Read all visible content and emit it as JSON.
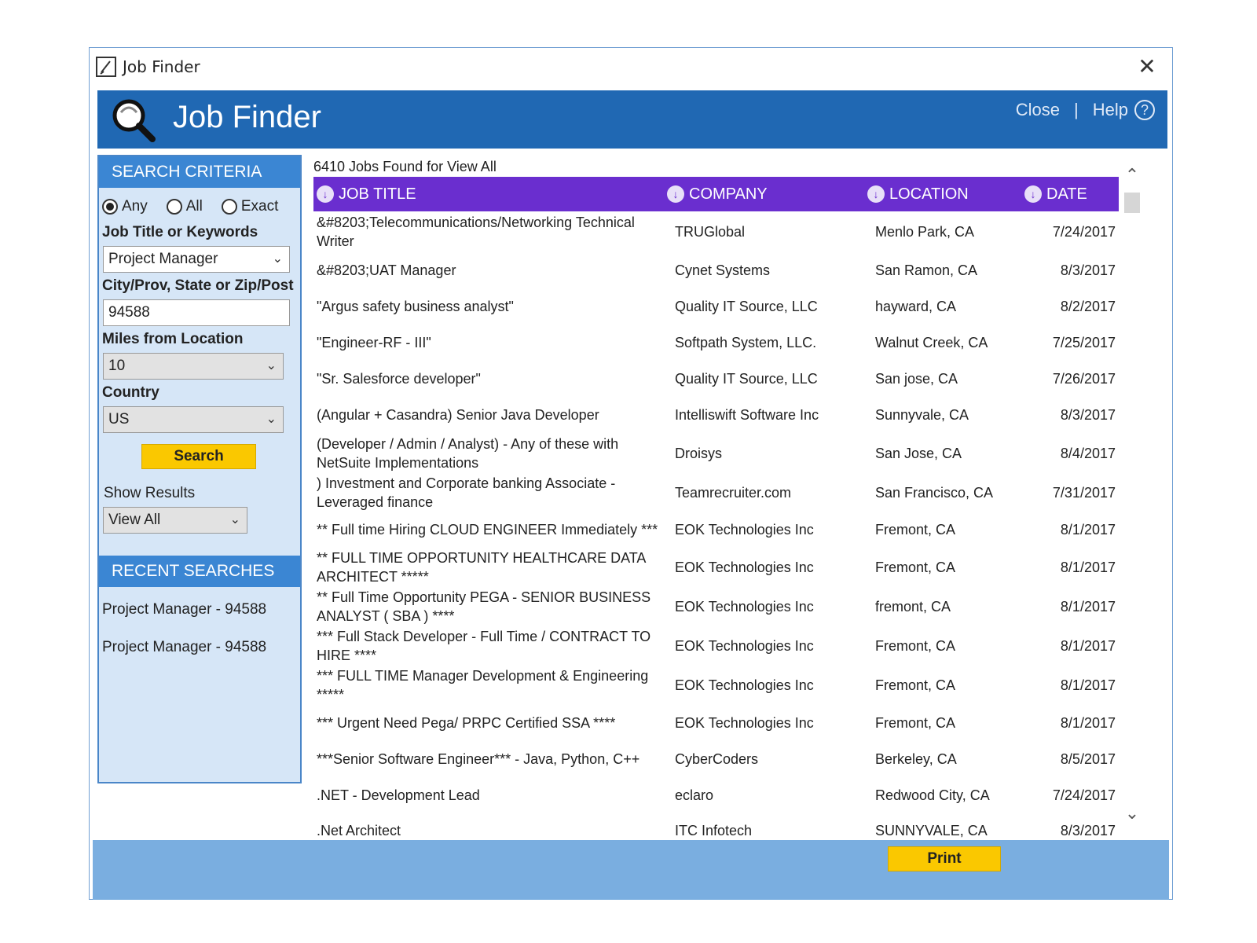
{
  "window": {
    "title": "Job Finder",
    "close_glyph": "✕"
  },
  "banner": {
    "title": "Job Finder",
    "close_label": "Close",
    "separator": "|",
    "help_label": "Help",
    "help_glyph": "?",
    "color": "#2068b3"
  },
  "sidebar": {
    "header": "SEARCH CRITERIA",
    "radios": [
      {
        "label": "Any",
        "selected": true
      },
      {
        "label": "All",
        "selected": false
      },
      {
        "label": "Exact",
        "selected": false
      }
    ],
    "keywords_label": "Job Title or Keywords",
    "keywords_value": "Project Manager",
    "location_label": "City/Prov, State or Zip/Post",
    "location_value": "94588",
    "miles_label": "Miles from Location",
    "miles_value": "10",
    "country_label": "Country",
    "country_value": "US",
    "search_button": "Search",
    "show_results_label": "Show Results",
    "show_results_value": "View All",
    "recent_header": "RECENT SEARCHES",
    "recent": [
      "Project Manager - 94588",
      "Project Manager - 94588"
    ]
  },
  "results": {
    "count_text": "6410 Jobs Found for View All",
    "columns": [
      "JOB TITLE",
      "COMPANY",
      "LOCATION",
      "DATE"
    ],
    "header_color": "#6a2ecf",
    "rows": [
      {
        "title": "&#8203;Telecommunications/Networking Technical Writer",
        "company": "TRUGlobal",
        "location": "Menlo Park, CA",
        "date": "7/24/2017"
      },
      {
        "title": "&#8203;UAT Manager",
        "company": "Cynet Systems",
        "location": "San Ramon, CA",
        "date": "8/3/2017"
      },
      {
        "title": "\"Argus safety business analyst\"",
        "company": "Quality IT Source, LLC",
        "location": "hayward, CA",
        "date": "8/2/2017"
      },
      {
        "title": "\"Engineer-RF - III\"",
        "company": "Softpath System, LLC.",
        "location": "Walnut Creek, CA",
        "date": "7/25/2017"
      },
      {
        "title": "\"Sr. Salesforce developer\"",
        "company": "Quality IT Source, LLC",
        "location": "San jose, CA",
        "date": "7/26/2017"
      },
      {
        "title": "(Angular + Casandra) Senior Java Developer",
        "company": "Intelliswift Software Inc",
        "location": "Sunnyvale, CA",
        "date": "8/3/2017"
      },
      {
        "title": "(Developer / Admin / Analyst) - Any of these with NetSuite Implementations",
        "company": "Droisys",
        "location": "San Jose, CA",
        "date": "8/4/2017"
      },
      {
        "title": ") Investment and Corporate banking Associate - Leveraged finance",
        "company": "Teamrecruiter.com",
        "location": "San Francisco, CA",
        "date": "7/31/2017"
      },
      {
        "title": "** Full time Hiring CLOUD ENGINEER Immediately ***",
        "company": "EOK Technologies Inc",
        "location": "Fremont, CA",
        "date": "8/1/2017"
      },
      {
        "title": "** FULL TIME OPPORTUNITY HEALTHCARE DATA ARCHITECT *****",
        "company": "EOK Technologies Inc",
        "location": "Fremont, CA",
        "date": "8/1/2017"
      },
      {
        "title": "** Full Time Opportunity PEGA - SENIOR BUSINESS ANALYST ( SBA ) ****",
        "company": "EOK Technologies Inc",
        "location": "fremont, CA",
        "date": "8/1/2017"
      },
      {
        "title": "*** Full Stack Developer - Full Time / CONTRACT TO HIRE ****",
        "company": "EOK Technologies Inc",
        "location": "Fremont, CA",
        "date": "8/1/2017"
      },
      {
        "title": "*** FULL TIME Manager Development & Engineering *****",
        "company": "EOK Technologies Inc",
        "location": "Fremont, CA",
        "date": "8/1/2017"
      },
      {
        "title": "*** Urgent Need Pega/ PRPC Certified SSA ****",
        "company": "EOK Technologies Inc",
        "location": "Fremont, CA",
        "date": "8/1/2017"
      },
      {
        "title": "***Senior Software Engineer*** - Java, Python, C++",
        "company": "CyberCoders",
        "location": "Berkeley, CA",
        "date": "8/5/2017"
      },
      {
        "title": ".NET - Development Lead",
        "company": "eclaro",
        "location": "Redwood City, CA",
        "date": "7/24/2017"
      },
      {
        "title": ".Net Architect",
        "company": "ITC Infotech",
        "location": "SUNNYVALE, CA",
        "date": "8/3/2017"
      }
    ]
  },
  "footer": {
    "print_button": "Print",
    "color": "#7aaee0"
  },
  "accent": {
    "button_yellow": "#fac800",
    "sidebar_bg": "#d6e6f7"
  },
  "icons": {
    "titlebar": "notepad-icon",
    "logo": "magnifier-icon",
    "sort": "sort-down-icon",
    "chevron": "chevron-down-icon"
  }
}
